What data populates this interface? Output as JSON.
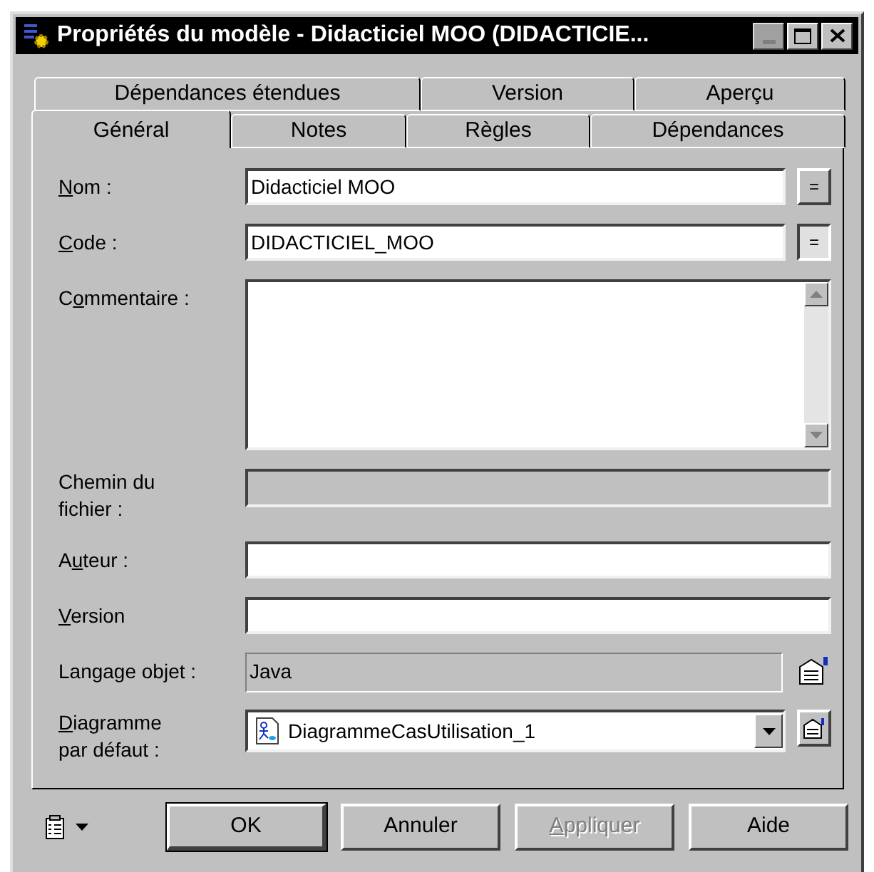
{
  "window": {
    "title": "Propriétés du modèle - Didacticiel MOO (DIDACTICIE..."
  },
  "tab_rows": [
    [
      {
        "label": "Dépendances étendues",
        "selected": false
      },
      {
        "label": "Version",
        "selected": false
      },
      {
        "label": "Aperçu",
        "selected": false
      }
    ],
    [
      {
        "label": "Général",
        "selected": true
      },
      {
        "label": "Notes",
        "selected": false
      },
      {
        "label": "Règles",
        "selected": false
      },
      {
        "label": "Dépendances",
        "selected": false
      }
    ]
  ],
  "fields": [
    {
      "kind": "text",
      "label": {
        "key": "N",
        "rest": "om :"
      },
      "value": "Didacticiel MOO",
      "side": {
        "kind": "equals",
        "text": "=",
        "pressed": false
      }
    },
    {
      "kind": "text",
      "label": {
        "key": "C",
        "rest": "ode :"
      },
      "value": "DIDACTICIEL_MOO",
      "side": {
        "kind": "equals",
        "text": "=",
        "pressed": true
      }
    },
    {
      "kind": "textarea",
      "label": {
        "before": "C",
        "key": "o",
        "rest": "mmentaire :"
      }
    },
    {
      "kind": "disabled",
      "label": {
        "rest": "Chemin du\nfichier :"
      }
    },
    {
      "kind": "text",
      "label": {
        "before": "A",
        "key": "u",
        "rest": "teur :"
      }
    },
    {
      "kind": "text",
      "label": {
        "key": "V",
        "rest": "ersion"
      }
    },
    {
      "kind": "readonly",
      "label": {
        "rest": "Langage objet :"
      },
      "value": "Java",
      "side": {
        "kind": "properties"
      }
    },
    {
      "kind": "combo",
      "label": {
        "key": "D",
        "rest": "iagramme\npar défaut :"
      },
      "value": "DiagrammeCasUtilisation_1",
      "side": {
        "kind": "properties-button"
      }
    }
  ],
  "buttons": [
    {
      "label": {
        "rest": "OK"
      },
      "default": true,
      "disabled": false
    },
    {
      "label": {
        "rest": "Annuler"
      },
      "default": false,
      "disabled": false
    },
    {
      "label": {
        "key": "A",
        "rest": "ppliquer"
      },
      "default": false,
      "disabled": true
    },
    {
      "label": {
        "rest": "Aide"
      },
      "default": false,
      "disabled": false
    }
  ]
}
